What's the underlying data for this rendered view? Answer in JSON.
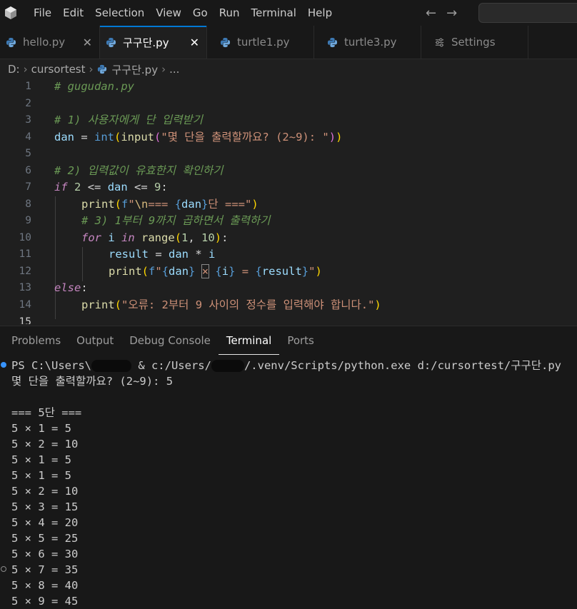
{
  "menu": [
    "File",
    "Edit",
    "Selection",
    "View",
    "Go",
    "Run",
    "Terminal",
    "Help"
  ],
  "tabs": [
    {
      "label": "hello.py",
      "active": false,
      "icon": "python-icon",
      "close": "✕"
    },
    {
      "label": "구구단.py",
      "active": true,
      "icon": "python-icon",
      "close": "✕"
    },
    {
      "label": "turtle1.py",
      "active": false,
      "icon": "python-icon",
      "close": ""
    },
    {
      "label": "turtle3.py",
      "active": false,
      "icon": "python-icon",
      "close": ""
    },
    {
      "label": "Settings",
      "active": false,
      "icon": "settings-icon",
      "close": ""
    }
  ],
  "breadcrumb": {
    "drive": "D:",
    "folder": "cursortest",
    "file": "구구단.py",
    "more": "..."
  },
  "editor": {
    "line_numbers": [
      "1",
      "2",
      "3",
      "4",
      "5",
      "6",
      "7",
      "8",
      "9",
      "10",
      "11",
      "12",
      "13",
      "14",
      "15"
    ],
    "lines": {
      "l1": "# gugudan.py",
      "l3": "# 1) 사용자에게 단 입력받기",
      "l4a": "dan",
      "l4b": " = ",
      "l4c": "int",
      "l4d": "(",
      "l4e": "input",
      "l4f": "(",
      "l4g": "\"몇 단을 출력할까요? (2~9): \"",
      "l4h": ")",
      "l4i": ")",
      "l6": "# 2) 입력값이 유효한지 확인하기",
      "l7a": "if",
      "l7b": " ",
      "l7c": "2",
      "l7d": " <= ",
      "l7e": "dan",
      "l7f": " <= ",
      "l7g": "9",
      "l7h": ":",
      "l8a": "print",
      "l8b": "(",
      "l8c": "f",
      "l8d": "\"",
      "l8e": "\\n",
      "l8f": "=== ",
      "l8g": "{",
      "l8h": "dan",
      "l8i": "}",
      "l8j": "단 ===\"",
      "l8k": ")",
      "l9": "# 3) 1부터 9까지 곱하면서 출력하기",
      "l10a": "for",
      "l10b": " i ",
      "l10c": "in",
      "l10d": " ",
      "l10e": "range",
      "l10f": "(",
      "l10g": "1",
      "l10h": ", ",
      "l10i": "10",
      "l10j": ")",
      "l10k": ":",
      "l11a": "result",
      "l11b": " = ",
      "l11c": "dan",
      "l11d": " * ",
      "l11e": "i",
      "l12a": "print",
      "l12b": "(",
      "l12c": "f",
      "l12d": "\"",
      "l12e": "{",
      "l12f": "dan",
      "l12g": "}",
      "l12h": " ",
      "l12i": "×",
      "l12j": " ",
      "l12k": "{",
      "l12l": "i",
      "l12m": "}",
      "l12n": " = ",
      "l12o": "{",
      "l12p": "result",
      "l12q": "}",
      "l12r": "\"",
      "l12s": ")",
      "l13a": "else",
      "l13b": ":",
      "l14a": "print",
      "l14b": "(",
      "l14c": "\"오류: 2부터 9 사이의 정수를 입력해야 합니다.\"",
      "l14d": ")"
    }
  },
  "panel": {
    "tabs": [
      "Problems",
      "Output",
      "Debug Console",
      "Terminal",
      "Ports"
    ],
    "active_tab": "Terminal"
  },
  "terminal": {
    "cmd_a": "PS C:\\Users\\",
    "cmd_b": " & c:/Users/",
    "cmd_c": "/.venv/Scripts/python.exe d:/cursortest/구구단.py",
    "prompt": "몇 단을 출력할까요? (2~9): 5",
    "header": "=== 5단 ===",
    "rows": [
      "5 × 1 = 5",
      "5 × 2 = 10",
      "5 × 1 = 5",
      "5 × 1 = 5",
      "5 × 2 = 10",
      "5 × 3 = 15",
      "5 × 4 = 20",
      "5 × 5 = 25",
      "5 × 6 = 30",
      "5 × 7 = 35",
      "5 × 8 = 40",
      "5 × 9 = 45"
    ]
  },
  "colors": {
    "accent": "#0078d4",
    "editor_bg": "#1f1f1f",
    "panel_bg": "#181818"
  }
}
